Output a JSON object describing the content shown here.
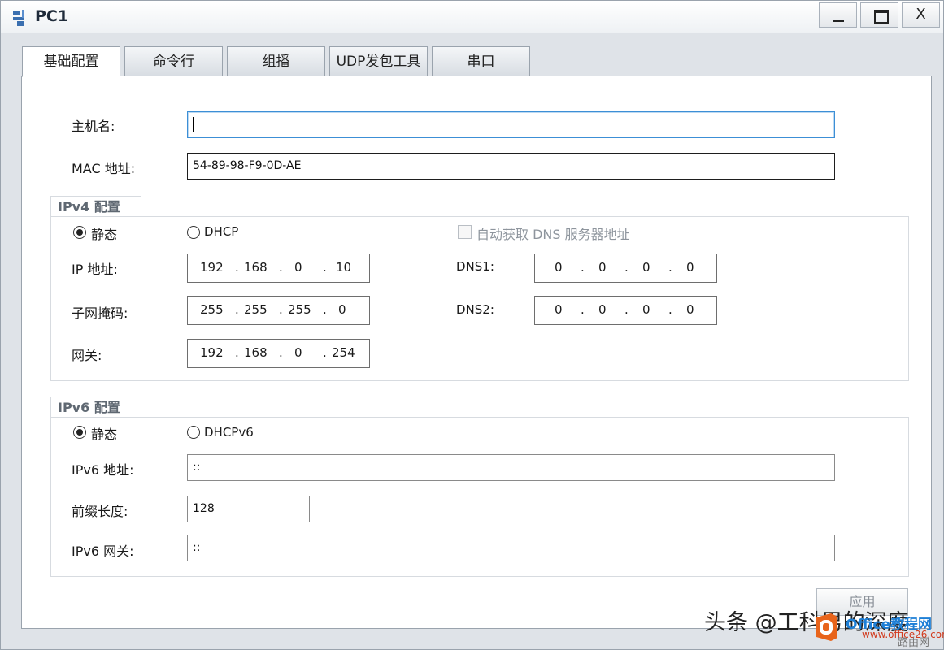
{
  "window": {
    "title": "PC1",
    "icon": "network-pc-icon"
  },
  "window_controls": {
    "minimize": "minimize-icon",
    "maximize": "maximize-icon",
    "close_glyph": "X"
  },
  "tabs": [
    {
      "label": "基础配置",
      "active": true
    },
    {
      "label": "命令行"
    },
    {
      "label": "组播"
    },
    {
      "label": "UDP发包工具"
    },
    {
      "label": "串口"
    }
  ],
  "basic": {
    "hostname_label": "主机名:",
    "hostname_value": "",
    "mac_label": "MAC 地址:",
    "mac_value": "54-89-98-F9-0D-AE"
  },
  "ipv4": {
    "group_title": "IPv4 配置",
    "static_label": "静态",
    "dhcp_label": "DHCP",
    "auto_dns_label": "自动获取 DNS 服务器地址",
    "ip_label": "IP 地址:",
    "ip": [
      "192",
      "168",
      "0",
      "10"
    ],
    "mask_label": "子网掩码:",
    "mask": [
      "255",
      "255",
      "255",
      "0"
    ],
    "gateway_label": "网关:",
    "gateway": [
      "192",
      "168",
      "0",
      "254"
    ],
    "dns1_label": "DNS1:",
    "dns1": [
      "0",
      "0",
      "0",
      "0"
    ],
    "dns2_label": "DNS2:",
    "dns2": [
      "0",
      "0",
      "0",
      "0"
    ]
  },
  "ipv6": {
    "group_title": "IPv6 配置",
    "static_label": "静态",
    "dhcp_label": "DHCPv6",
    "addr_label": "IPv6 地址:",
    "addr_value": "::",
    "prefix_label": "前缀长度:",
    "prefix_value": "128",
    "gateway_label": "IPv6 网关:",
    "gateway_value": "::"
  },
  "apply_label": "应用",
  "watermark": {
    "text": "头条 @工科男的深度",
    "site_name": "Office教程网",
    "site_url": "www.office26.com",
    "router_text": "路由网"
  },
  "colors": {
    "focus_border": "#3c8fd6",
    "site_blue": "#1e7fd6",
    "logo_orange": "#e8641b"
  }
}
